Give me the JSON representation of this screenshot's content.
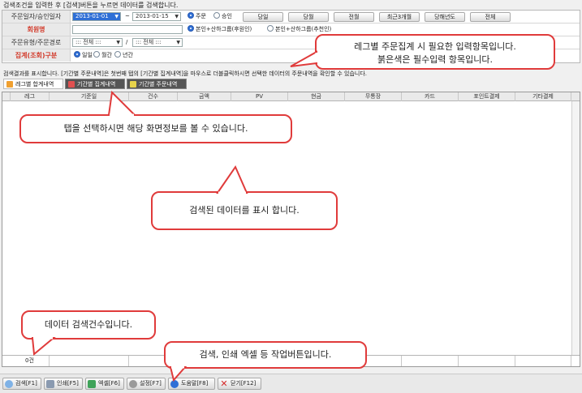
{
  "hint_top": "검색조건을 입력한 후 [검색]버튼을 누르면 데이터를 검색합니다.",
  "form": {
    "row1": {
      "label": "주문일자/승인일자",
      "date_from": "2013-01-01",
      "separator": "~",
      "date_to": "2013-01-15",
      "radio_order": "주문",
      "radio_approve": "승인",
      "buttons": [
        "당일",
        "당월",
        "전월",
        "최근3개월",
        "당해년도",
        "전체"
      ]
    },
    "row2": {
      "label": "회원명",
      "radio_a": "본인+산하그룹(후원인)",
      "radio_b": "본인+산하그룹(추천인)"
    },
    "row3": {
      "label": "주문유형/주문경로",
      "select_a": "::: 전체 :::",
      "slash": "/",
      "select_b": "::: 전체 :::"
    },
    "row4": {
      "label": "집계(조회)구분",
      "radio_daily": "일일",
      "radio_monthly": "월간",
      "radio_yearly": "년간"
    }
  },
  "info_line": "검색결과를 표시합니다. [기간별 주문내역]은 첫번째 탭의 [기간별 집계내역]을 마우스로 더블클릭하시면 선택한 데이터의 주문내역을 확인할 수 있습니다.",
  "tabs": [
    "레그별 합계내역",
    "기간별 집계내역",
    "기간별 주문내역"
  ],
  "grid": {
    "columns": [
      "레그",
      "기준일",
      "건수",
      "금액",
      "PV",
      "현금",
      "무통장",
      "카드",
      "포인트결제",
      "기타결제"
    ],
    "count": "0건"
  },
  "bottom_buttons": [
    "검색[F1]",
    "인쇄[F5]",
    "엑셀[F6]",
    "설정[F7]",
    "도움말[F8]",
    "닫기[F12]"
  ],
  "callouts": {
    "input": [
      "레그별 주문집계 시 필요한 입력항목입니다.",
      "붉은색은 필수입력 항목입니다."
    ],
    "tab": "탭을 선택하시면 해당 화면정보를 볼 수 있습니다.",
    "data": "검색된 데이터를 표시 합니다.",
    "count": "데이터 검색건수입니다.",
    "buttons": "검색, 인쇄 엑셀 등 작업버튼입니다."
  },
  "colors": {
    "required_label": "#d23a2a",
    "callout_border": "#e03b3b",
    "selected_date": "#2f6fd6"
  }
}
